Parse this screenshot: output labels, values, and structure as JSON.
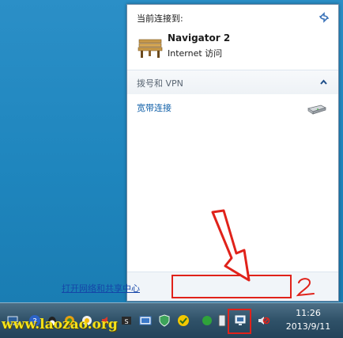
{
  "flyout": {
    "current_label": "当前连接到:",
    "network": {
      "name": "Navigator  2",
      "status": "Internet 访问"
    },
    "dialup_section": {
      "label": "拨号和 VPN"
    },
    "connection": {
      "label": "宽带连接"
    },
    "footer": {
      "open_center_label": "打开网络和共享中心"
    }
  },
  "annotation": {
    "number": "2",
    "color": "#e0221a"
  },
  "taskbar": {
    "clock_time": "11:26",
    "clock_date": "2013/9/11",
    "watermark": "www.laozao.org"
  },
  "icons": [
    "refresh-icon",
    "bench-network-icon",
    "collapse-chevron-icon",
    "modem-icon",
    "network-tray-icon",
    "volume-muted-icon"
  ]
}
